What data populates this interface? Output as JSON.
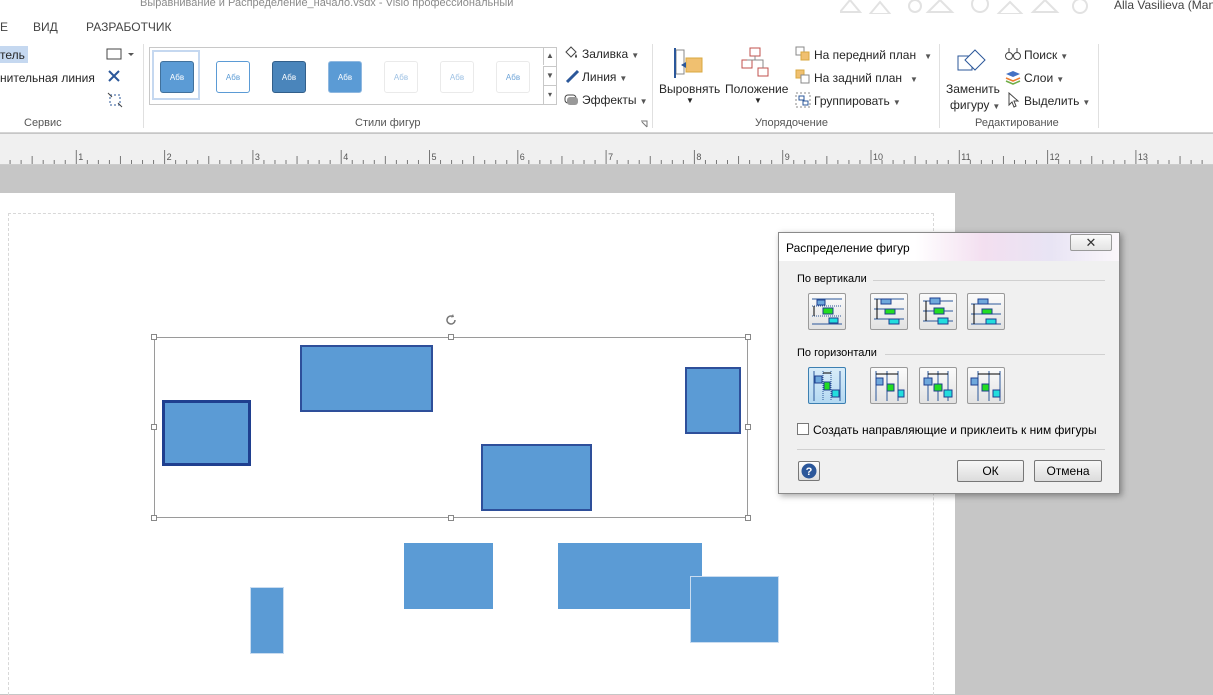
{
  "window": {
    "title": "Выравнивание и Распределение_начало.vsdx -  Visio профессиональный",
    "user": "Alla Vasilieva (Man"
  },
  "tabs": [
    "Е",
    "ВИД",
    "РАЗРАБОТЧИК"
  ],
  "ribbon": {
    "service": {
      "pointer_label": "тель",
      "connector_label": "нительная линия",
      "group_label": "Сервис"
    },
    "styles": {
      "swatch_text": "Абв",
      "group_label": "Стили фигур",
      "fill": "Заливка",
      "line": "Линия",
      "effects": "Эффекты"
    },
    "arrange": {
      "align": "Выровнять",
      "position": "Положение",
      "bring_front": "На передний план",
      "send_back": "На задний план",
      "group": "Группировать",
      "group_label": "Упорядочение"
    },
    "editing": {
      "change_shape_1": "Заменить",
      "change_shape_2": "фигуру",
      "find": "Поиск",
      "layers": "Слои",
      "select": "Выделить",
      "group_label": "Редактирование"
    }
  },
  "ruler": {
    "labels": [
      "1",
      "2",
      "3",
      "4",
      "5",
      "6",
      "7",
      "8",
      "9",
      "10",
      "11",
      "12",
      "13"
    ]
  },
  "dialog": {
    "title": "Распределение фигур",
    "vertical_label": "По вертикали",
    "horizontal_label": "По горизонтали",
    "checkbox_label": "Создать направляющие и приклеить к ним фигуры",
    "checkbox_checked": false,
    "ok": "ОК",
    "cancel": "Отмена",
    "selected_horizontal_option": 1
  },
  "colors": {
    "shape_fill": "#5b9bd5",
    "shape_outline": "#2e4f9a",
    "accent": "#2b579a"
  }
}
